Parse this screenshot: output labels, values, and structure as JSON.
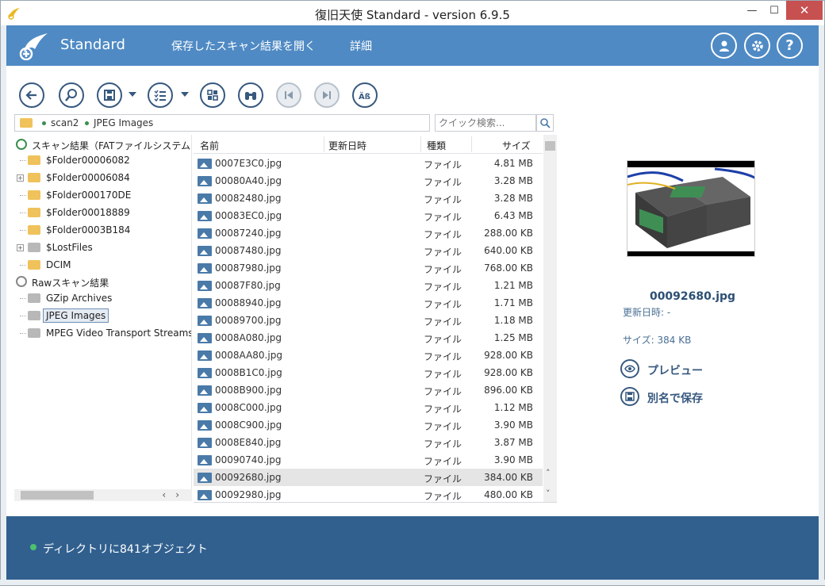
{
  "window": {
    "title": "復旧天使 Standard - version 6.9.5",
    "minimize": "—",
    "maximize": "☐",
    "close": "✕"
  },
  "header": {
    "brand": "Standard",
    "nav_open": "保存したスキャン結果を開く",
    "nav_detail": "詳細",
    "accent_color": "#4f8ac4"
  },
  "toolbar": {
    "buttons": [
      "back-icon",
      "search-zoom-icon",
      "save-icon",
      "checklist-icon",
      "tiles-icon",
      "binoculars-icon",
      "prev-icon",
      "next-icon",
      "text-case-icon"
    ]
  },
  "path": {
    "items": [
      "scan2",
      "JPEG Images"
    ]
  },
  "search": {
    "placeholder": "クイック検索..."
  },
  "tree": {
    "root1": "スキャン結果（FATファイルシステム",
    "folders": [
      "$Folder00006082",
      "$Folder00006084",
      "$Folder000170DE",
      "$Folder00018889",
      "$Folder0003B184",
      "$LostFiles",
      "DCIM"
    ],
    "root2": "Rawスキャン結果",
    "raw_items": [
      "GZip Archives",
      "JPEG Images",
      "MPEG Video Transport Streams"
    ]
  },
  "columns": {
    "name": "名前",
    "modified": "更新日時",
    "type": "種類",
    "size": "サイズ"
  },
  "files": [
    {
      "name": "0007E3C0.jpg",
      "type": "ファイル",
      "size": "4.81 MB"
    },
    {
      "name": "00080A40.jpg",
      "type": "ファイル",
      "size": "3.28 MB"
    },
    {
      "name": "00082480.jpg",
      "type": "ファイル",
      "size": "3.28 MB"
    },
    {
      "name": "00083EC0.jpg",
      "type": "ファイル",
      "size": "6.43 MB"
    },
    {
      "name": "00087240.jpg",
      "type": "ファイル",
      "size": "288.00 KB"
    },
    {
      "name": "00087480.jpg",
      "type": "ファイル",
      "size": "640.00 KB"
    },
    {
      "name": "00087980.jpg",
      "type": "ファイル",
      "size": "768.00 KB"
    },
    {
      "name": "00087F80.jpg",
      "type": "ファイル",
      "size": "1.21 MB"
    },
    {
      "name": "00088940.jpg",
      "type": "ファイル",
      "size": "1.71 MB"
    },
    {
      "name": "00089700.jpg",
      "type": "ファイル",
      "size": "1.18 MB"
    },
    {
      "name": "0008A080.jpg",
      "type": "ファイル",
      "size": "1.25 MB"
    },
    {
      "name": "0008AA80.jpg",
      "type": "ファイル",
      "size": "928.00 KB"
    },
    {
      "name": "0008B1C0.jpg",
      "type": "ファイル",
      "size": "928.00 KB"
    },
    {
      "name": "0008B900.jpg",
      "type": "ファイル",
      "size": "896.00 KB"
    },
    {
      "name": "0008C000.jpg",
      "type": "ファイル",
      "size": "1.12 MB"
    },
    {
      "name": "0008C900.jpg",
      "type": "ファイル",
      "size": "3.90 MB"
    },
    {
      "name": "0008E840.jpg",
      "type": "ファイル",
      "size": "3.87 MB"
    },
    {
      "name": "00090740.jpg",
      "type": "ファイル",
      "size": "3.90 MB"
    },
    {
      "name": "00092680.jpg",
      "type": "ファイル",
      "size": "384.00 KB"
    },
    {
      "name": "00092980.jpg",
      "type": "ファイル",
      "size": "480.00 KB"
    }
  ],
  "selected_index": 18,
  "preview": {
    "filename": "00092680.jpg",
    "modified": "更新日時: -",
    "size": "サイズ: 384 KB",
    "preview_action": "プレビュー",
    "save_as_action": "別名で保存"
  },
  "status": {
    "text": "ディレクトリに841オブジェクト",
    "color": "#31608f"
  }
}
